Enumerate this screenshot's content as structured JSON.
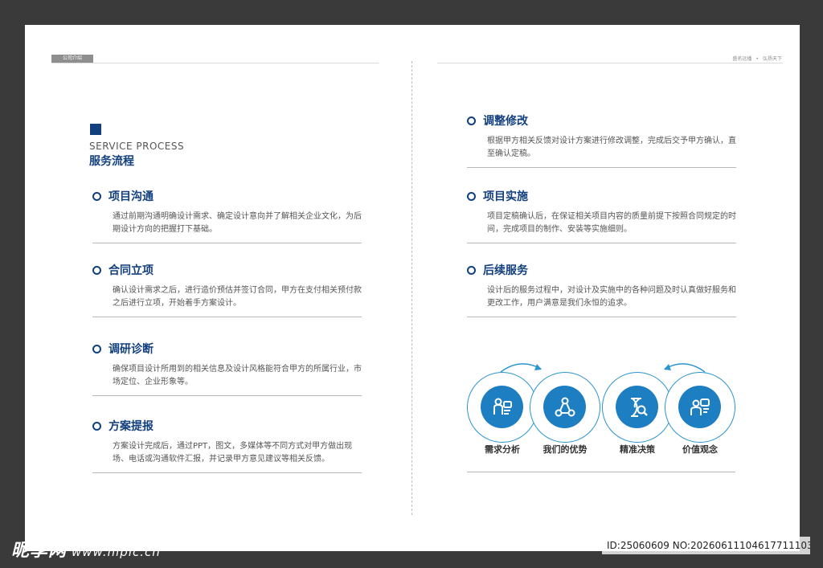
{
  "header": {
    "left_tag": "公司介绍",
    "right_text_1": "盛名远播",
    "right_dot": "•",
    "right_text_2": "弘扬天下"
  },
  "section": {
    "title_en": "SERVICE PROCESS",
    "title_zh": "服务流程"
  },
  "left_items": [
    {
      "title": "项目沟通",
      "desc": "通过前期沟通明确设计需求、确定设计意向并了解相关企业文化，为后期设计方向的把握打下基础。"
    },
    {
      "title": "合同立项",
      "desc": "确认设计需求之后，进行造价预估并签订合同，甲方在支付相关预付款之后进行立项，开始着手方案设计。"
    },
    {
      "title": "调研诊断",
      "desc": "确保项目设计所用到的相关信息及设计风格能符合甲方的所属行业，市场定位、企业形象等。"
    },
    {
      "title": "方案提报",
      "desc": "方案设计完成后，通过PPT，图文，多媒体等不同方式对甲方做出现场、电话或沟通软件汇报，并记录甲方意见建议等相关反馈。"
    }
  ],
  "right_items": [
    {
      "title": "调整修改",
      "desc": "根据甲方相关反馈对设计方案进行修改调整，完成后交予甲方确认，直至确认定稿。"
    },
    {
      "title": "项目实施",
      "desc": "项目定稿确认后，在保证相关项目内容的质量前提下按照合同规定的时间，完成项目的制作、安装等实施细则。"
    },
    {
      "title": "后续服务",
      "desc": "设计后的服务过程中，对设计及实施中的各种问题及时认真做好服务和更改工作，用户满意是我们永恒的追求。"
    }
  ],
  "circles": [
    {
      "label": "需求分析",
      "icon": "people-chat-icon"
    },
    {
      "label": "我们的优势",
      "icon": "network-nodes-icon"
    },
    {
      "label": "精准决策",
      "icon": "dna-search-icon"
    },
    {
      "label": "价值观念",
      "icon": "person-chat-icon"
    }
  ],
  "watermark": {
    "brand": "昵享网",
    "url": "www.nipic.cn",
    "id_text": "ID:25060609 NO:20260611104617711103"
  },
  "colors": {
    "primary": "#123f7e",
    "accent": "#1e7ec2",
    "ring": "#2b95cf",
    "background": "#3b3a3b"
  }
}
